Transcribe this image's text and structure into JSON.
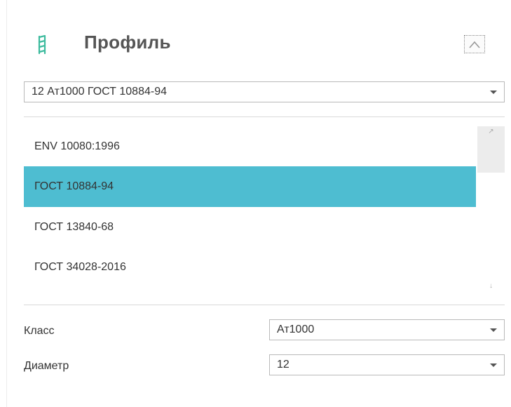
{
  "profile": {
    "title": "Профиль",
    "selected_value": "12 Ат1000 ГОСТ 10884-94",
    "icon": "rebar-profile-icon",
    "collapse_icon": "chevron-up-icon",
    "accent_color": "#4ebdd1",
    "icon_color": "#3dbb9e"
  },
  "standards": {
    "items": [
      {
        "label": "ENV 10080:1996",
        "selected": false
      },
      {
        "label": "ГОСТ 10884-94",
        "selected": true
      },
      {
        "label": "ГОСТ 13840-68",
        "selected": false
      },
      {
        "label": "ГОСТ 34028-2016",
        "selected": false
      }
    ]
  },
  "fields": {
    "class_label": "Класс",
    "class_value": "Ат1000",
    "diameter_label": "Диаметр",
    "diameter_value": "12"
  }
}
